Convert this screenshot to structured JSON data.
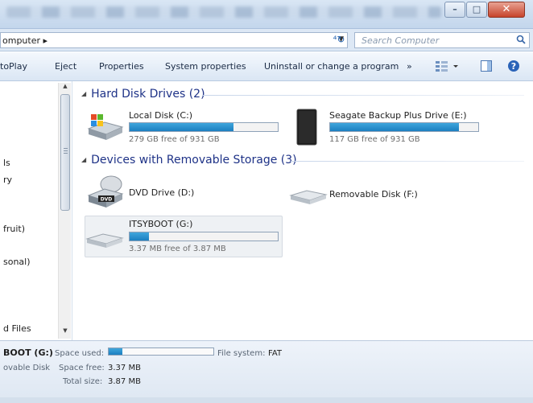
{
  "window": {
    "controls": {
      "minimize": "–",
      "maximize": "□",
      "close": "✕"
    }
  },
  "address": {
    "crumb": "omputer",
    "crumb_arrow": "▸",
    "search_placeholder": "Search Computer"
  },
  "toolbar": {
    "autoplay": "toPlay",
    "eject": "Eject",
    "properties": "Properties",
    "system_properties": "System properties",
    "uninstall": "Uninstall or change a program",
    "more": "»"
  },
  "nav": {
    "items": [
      "ls",
      "ry",
      "",
      "fruit)",
      "sonal)",
      "d Files"
    ]
  },
  "groups": {
    "hard_disk": "Hard Disk Drives (2)",
    "removable": "Devices with Removable Storage (3)"
  },
  "drives": {
    "local": {
      "name": "Local Disk (C:)",
      "free": "279 GB free of 931 GB",
      "used_fraction": 0.7
    },
    "seagate": {
      "name": "Seagate Backup Plus Drive (E:)",
      "free": "117 GB free of 931 GB",
      "used_fraction": 0.87
    },
    "dvd": {
      "name": "DVD Drive (D:)"
    },
    "removable": {
      "name": "Removable Disk (F:)"
    },
    "itsyboot": {
      "name": "ITSYBOOT (G:)",
      "free": "3.37 MB free of 3.87 MB",
      "used_fraction": 0.13
    }
  },
  "details": {
    "name": "BOOT (G:)",
    "type": "ovable Disk",
    "space_used_label": "Space used:",
    "space_free_label": "Space free:",
    "space_free": "3.37 MB",
    "total_size_label": "Total size:",
    "total_size": "3.87 MB",
    "filesystem_label": "File system:",
    "filesystem": "FAT",
    "used_fraction": 0.13
  },
  "colors": {
    "bar_fill": "#1c7fc0",
    "group_text": "#1e3287"
  }
}
